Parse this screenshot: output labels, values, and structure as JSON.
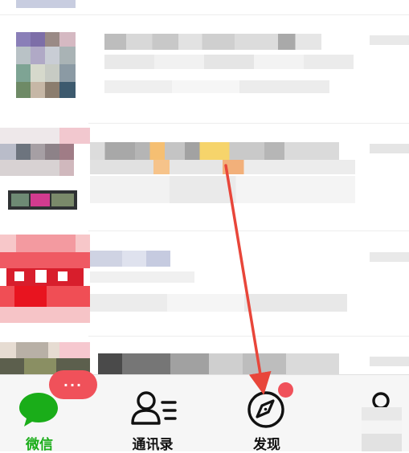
{
  "tabbar": {
    "chats": {
      "label": "微信",
      "icon": "chat-bubble-icon",
      "badge": "···"
    },
    "contacts": {
      "label": "通讯录",
      "icon": "contacts-icon"
    },
    "discover": {
      "label": "发现",
      "icon": "compass-icon"
    },
    "me": {
      "icon": "person-icon"
    }
  },
  "colors": {
    "accent": "#1aad19",
    "badge": "#f0515a",
    "arrow": "#e8463a",
    "tabbar_bg": "#f6f6f6"
  }
}
